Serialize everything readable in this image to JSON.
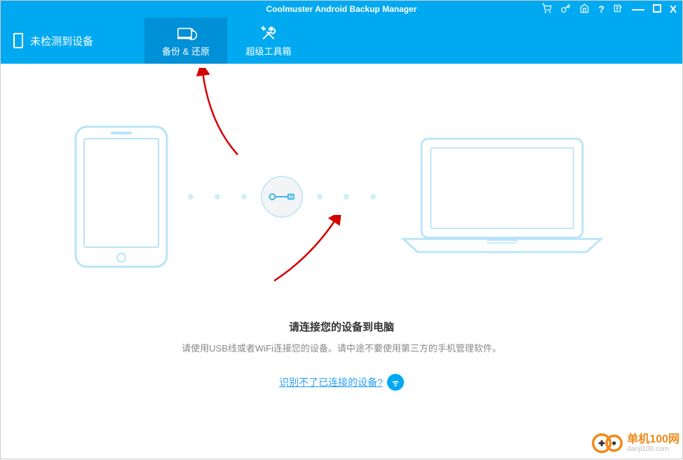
{
  "titlebar": {
    "title": "Coolmuster Android Backup Manager"
  },
  "header": {
    "device_status": "未检测到设备",
    "tabs": [
      {
        "label": "备份 & 还原",
        "active": true
      },
      {
        "label": "超级工具箱",
        "active": false
      }
    ]
  },
  "content": {
    "message_title": "请连接您的设备到电脑",
    "message_sub": "请使用USB线或者WiFi连接您的设备。请中途不要使用第三方的手机管理软件。",
    "help_link": "识别不了已连接的设备?"
  },
  "watermark": {
    "name": "单机100网",
    "url": "danji100.com"
  }
}
